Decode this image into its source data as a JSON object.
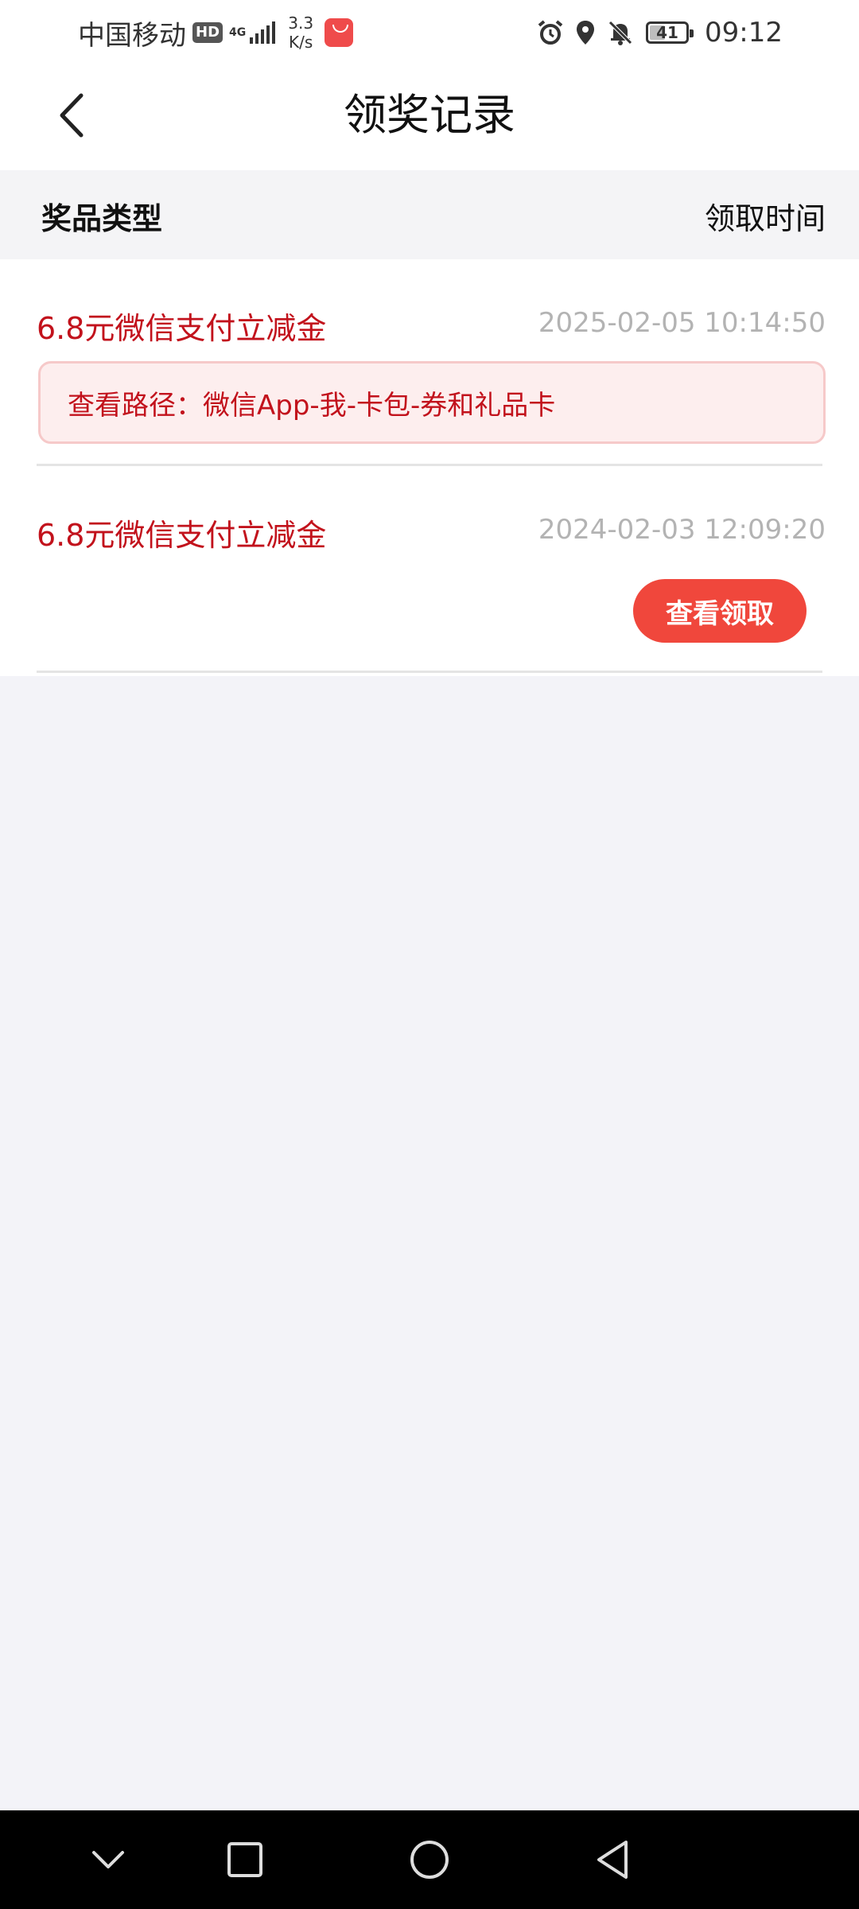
{
  "status_bar": {
    "carrier": "中国移动",
    "hd": "HD",
    "network": "4G",
    "speed_value": "3.3",
    "speed_unit": "K/s",
    "battery": "41",
    "time": "09:12",
    "icons": [
      "huawei-app-icon",
      "alarm-icon",
      "location-icon",
      "bell-mute-icon",
      "battery-icon"
    ]
  },
  "nav": {
    "title": "领奖记录",
    "back_icon": "chevron-left-icon"
  },
  "table_header": {
    "col_type": "奖品类型",
    "col_time": "领取时间"
  },
  "records": [
    {
      "prize": "6.8元微信支付立减金",
      "time": "2025-02-05 10:14:50",
      "path": "查看路径：微信App-我-卡包-券和礼品卡"
    },
    {
      "prize": "6.8元微信支付立减金",
      "time": "2024-02-03 12:09:20",
      "button": "查看领取"
    }
  ],
  "system_nav": [
    "collapse-icon",
    "recents-icon",
    "home-icon",
    "back-icon"
  ],
  "colors": {
    "accent_red": "#c2121c",
    "button_red": "#f0473c",
    "path_bg": "#fdeeee",
    "page_bg": "#f3f3f8"
  }
}
